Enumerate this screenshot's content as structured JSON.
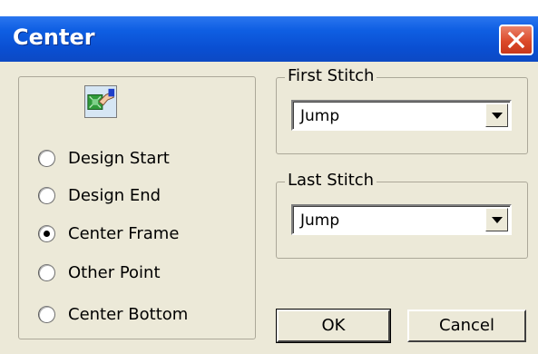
{
  "window": {
    "title": "Center"
  },
  "left_group": {
    "options": [
      {
        "label": "Design Start",
        "checked": false
      },
      {
        "label": "Design End",
        "checked": false
      },
      {
        "label": "Center Frame",
        "checked": true
      },
      {
        "label": "Other Point",
        "checked": false
      },
      {
        "label": "Center Bottom",
        "checked": false
      }
    ]
  },
  "first_stitch": {
    "legend": "First Stitch",
    "value": "Jump"
  },
  "last_stitch": {
    "legend": "Last Stitch",
    "value": "Jump"
  },
  "buttons": {
    "ok": "OK",
    "cancel": "Cancel"
  }
}
